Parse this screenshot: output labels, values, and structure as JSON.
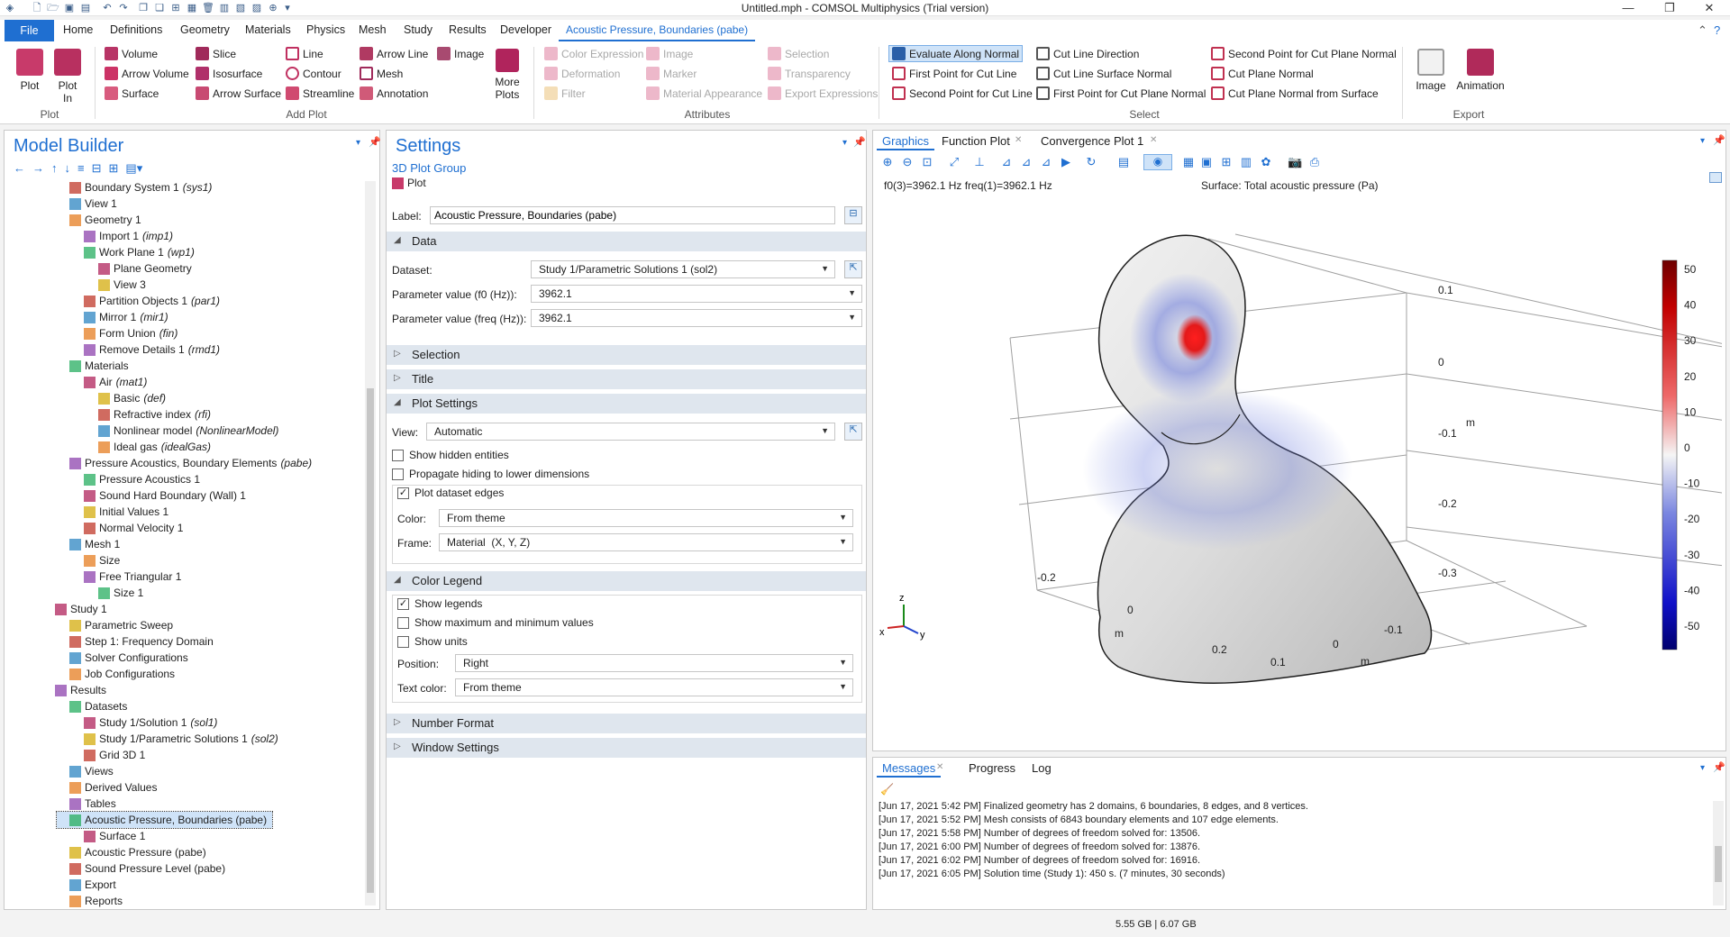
{
  "window": {
    "title": "Untitled.mph - COMSOL Multiphysics (Trial version)"
  },
  "menu": {
    "file": "File",
    "items": [
      "Home",
      "Definitions",
      "Geometry",
      "Materials",
      "Physics",
      "Mesh",
      "Study",
      "Results",
      "Developer"
    ],
    "active_tab": "Acoustic Pressure, Boundaries (pabe)"
  },
  "ribbon": {
    "plot_group": {
      "plot": "Plot",
      "plot_in": "Plot\nIn",
      "label": "Plot"
    },
    "add_plot": {
      "label": "Add Plot",
      "col1": [
        "Volume",
        "Arrow Volume",
        "Surface"
      ],
      "col2": [
        "Slice",
        "Isosurface",
        "Arrow Surface"
      ],
      "col3": [
        "Line",
        "Contour",
        "Streamline"
      ],
      "col4": [
        "Arrow Line",
        "Mesh",
        "Annotation"
      ],
      "col5": [
        "Image"
      ],
      "more": "More\nPlots"
    },
    "attributes": {
      "label": "Attributes",
      "col1": [
        "Color Expression",
        "Deformation",
        "Filter"
      ],
      "col2": [
        "Image",
        "Marker",
        "Material Appearance"
      ],
      "col3": [
        "Selection",
        "Transparency",
        "Export Expressions"
      ]
    },
    "select": {
      "label": "Select",
      "col1": [
        "Evaluate Along Normal",
        "First Point for Cut Line",
        "Second Point for Cut Line"
      ],
      "col2": [
        "Cut Line Direction",
        "Cut Line Surface Normal",
        "First Point for Cut Plane Normal"
      ],
      "col3": [
        "Second Point for Cut Plane Normal",
        "Cut Plane Normal",
        "Cut Plane Normal from Surface"
      ]
    },
    "export": {
      "label": "Export",
      "image": "Image",
      "animation": "Animation"
    }
  },
  "model_builder": {
    "title": "Model Builder",
    "tree": [
      {
        "label": "Boundary System 1",
        "tag": "(sys1)",
        "indent": 0
      },
      {
        "label": "View 1",
        "tag": "",
        "indent": 0
      },
      {
        "label": "Geometry 1",
        "tag": "",
        "indent": 0
      },
      {
        "label": "Import 1",
        "tag": "(imp1)",
        "indent": 1
      },
      {
        "label": "Work Plane 1",
        "tag": "(wp1)",
        "indent": 1
      },
      {
        "label": "Plane Geometry",
        "tag": "",
        "indent": 2
      },
      {
        "label": "View 3",
        "tag": "",
        "indent": 2
      },
      {
        "label": "Partition Objects 1",
        "tag": "(par1)",
        "indent": 1
      },
      {
        "label": "Mirror 1",
        "tag": "(mir1)",
        "indent": 1
      },
      {
        "label": "Form Union",
        "tag": "(fin)",
        "indent": 1
      },
      {
        "label": "Remove Details 1",
        "tag": "(rmd1)",
        "indent": 1
      },
      {
        "label": "Materials",
        "tag": "",
        "indent": 0
      },
      {
        "label": "Air",
        "tag": "(mat1)",
        "indent": 1
      },
      {
        "label": "Basic",
        "tag": "(def)",
        "indent": 2
      },
      {
        "label": "Refractive index",
        "tag": "(rfi)",
        "indent": 2
      },
      {
        "label": "Nonlinear model",
        "tag": "(NonlinearModel)",
        "indent": 2
      },
      {
        "label": "Ideal gas",
        "tag": "(idealGas)",
        "indent": 2
      },
      {
        "label": "Pressure Acoustics, Boundary Elements",
        "tag": "(pabe)",
        "indent": 0
      },
      {
        "label": "Pressure Acoustics 1",
        "tag": "",
        "indent": 1
      },
      {
        "label": "Sound Hard Boundary (Wall) 1",
        "tag": "",
        "indent": 1
      },
      {
        "label": "Initial Values 1",
        "tag": "",
        "indent": 1
      },
      {
        "label": "Normal Velocity 1",
        "tag": "",
        "indent": 1
      },
      {
        "label": "Mesh 1",
        "tag": "",
        "indent": 0
      },
      {
        "label": "Size",
        "tag": "",
        "indent": 1
      },
      {
        "label": "Free Triangular 1",
        "tag": "",
        "indent": 1
      },
      {
        "label": "Size 1",
        "tag": "",
        "indent": 2
      },
      {
        "label": "Study 1",
        "tag": "",
        "indent": -1
      },
      {
        "label": "Parametric Sweep",
        "tag": "",
        "indent": 0
      },
      {
        "label": "Step 1: Frequency Domain",
        "tag": "",
        "indent": 0
      },
      {
        "label": "Solver Configurations",
        "tag": "",
        "indent": 0
      },
      {
        "label": "Job Configurations",
        "tag": "",
        "indent": 0
      },
      {
        "label": "Results",
        "tag": "",
        "indent": -1
      },
      {
        "label": "Datasets",
        "tag": "",
        "indent": 0
      },
      {
        "label": "Study 1/Solution 1",
        "tag": "(sol1)",
        "indent": 1
      },
      {
        "label": "Study 1/Parametric Solutions 1",
        "tag": "(sol2)",
        "indent": 1
      },
      {
        "label": "Grid 3D 1",
        "tag": "",
        "indent": 1
      },
      {
        "label": "Views",
        "tag": "",
        "indent": 0
      },
      {
        "label": "Derived Values",
        "tag": "",
        "indent": 0
      },
      {
        "label": "Tables",
        "tag": "",
        "indent": 0
      },
      {
        "label": "Acoustic Pressure, Boundaries (pabe)",
        "tag": "",
        "indent": 0
      },
      {
        "label": "Surface 1",
        "tag": "",
        "indent": 1
      },
      {
        "label": "Acoustic Pressure (pabe)",
        "tag": "",
        "indent": 0
      },
      {
        "label": "Sound Pressure Level (pabe)",
        "tag": "",
        "indent": 0
      },
      {
        "label": "Export",
        "tag": "",
        "indent": 0
      },
      {
        "label": "Reports",
        "tag": "",
        "indent": 0
      }
    ]
  },
  "settings": {
    "title": "Settings",
    "subtitle": "3D Plot Group",
    "plot_button": "Plot",
    "label_caption": "Label:",
    "label_value": "Acoustic Pressure, Boundaries (pabe)",
    "data_section": "Data",
    "dataset_label": "Dataset:",
    "dataset_value": "Study 1/Parametric Solutions 1 (sol2)",
    "param_f0_label": "Parameter value (f0 (Hz)):",
    "param_f0_value": "3962.1",
    "param_freq_label": "Parameter value (freq (Hz)):",
    "param_freq_value": "3962.1",
    "selection_section": "Selection",
    "title_section": "Title",
    "plot_settings_section": "Plot Settings",
    "view_label": "View:",
    "view_value": "Automatic",
    "show_hidden": "Show hidden entities",
    "propagate_hiding": "Propagate hiding to lower dimensions",
    "plot_edges": "Plot dataset edges",
    "color_label": "Color:",
    "color_value": "From theme",
    "frame_label": "Frame:",
    "frame_value": "Material  (X, Y, Z)",
    "color_legend_section": "Color Legend",
    "show_legends": "Show legends",
    "show_maxmin": "Show maximum and minimum values",
    "show_units": "Show units",
    "position_label": "Position:",
    "position_value": "Right",
    "text_color_label": "Text color:",
    "text_color_value": "From theme",
    "number_format_section": "Number Format",
    "window_settings_section": "Window Settings"
  },
  "graphics": {
    "tabs": [
      "Graphics",
      "Function Plot",
      "Convergence Plot 1"
    ],
    "header_left": "f0(3)=3962.1 Hz freq(1)=3962.1 Hz",
    "header_right": "Surface: Total acoustic pressure (Pa)",
    "legend_ticks": [
      "50",
      "40",
      "30",
      "20",
      "10",
      "0",
      "-10",
      "-20",
      "-30",
      "-40",
      "-50"
    ],
    "axis_right": [
      "0.1",
      "0",
      "-0.1",
      "-0.2",
      "-0.3"
    ],
    "axis_right_unit": "m",
    "axis_bottom_left": [
      "-0.2",
      "0",
      "0.2"
    ],
    "axis_bottom_left_unit": "m",
    "axis_bottom_right": [
      "0.1",
      "0",
      "-0.1"
    ],
    "axis_bottom_right_unit": "m",
    "triad": {
      "z": "z",
      "x": "x",
      "y": "y"
    }
  },
  "messages": {
    "tabs": [
      "Messages",
      "Progress",
      "Log"
    ],
    "lines": [
      "[Jun 17, 2021 5:42 PM] Finalized geometry has 2 domains, 6 boundaries, 8 edges, and 8 vertices.",
      "[Jun 17, 2021 5:52 PM] Mesh consists of 6843 boundary elements and 107 edge elements.",
      "[Jun 17, 2021 5:58 PM] Number of degrees of freedom solved for: 13506.",
      "[Jun 17, 2021 6:00 PM] Number of degrees of freedom solved for: 13876.",
      "[Jun 17, 2021 6:02 PM] Number of degrees of freedom solved for: 16916.",
      "[Jun 17, 2021 6:05 PM] Solution time (Study 1): 450 s. (7 minutes, 30 seconds)"
    ]
  },
  "status": {
    "memory": "5.55 GB | 6.07 GB"
  }
}
